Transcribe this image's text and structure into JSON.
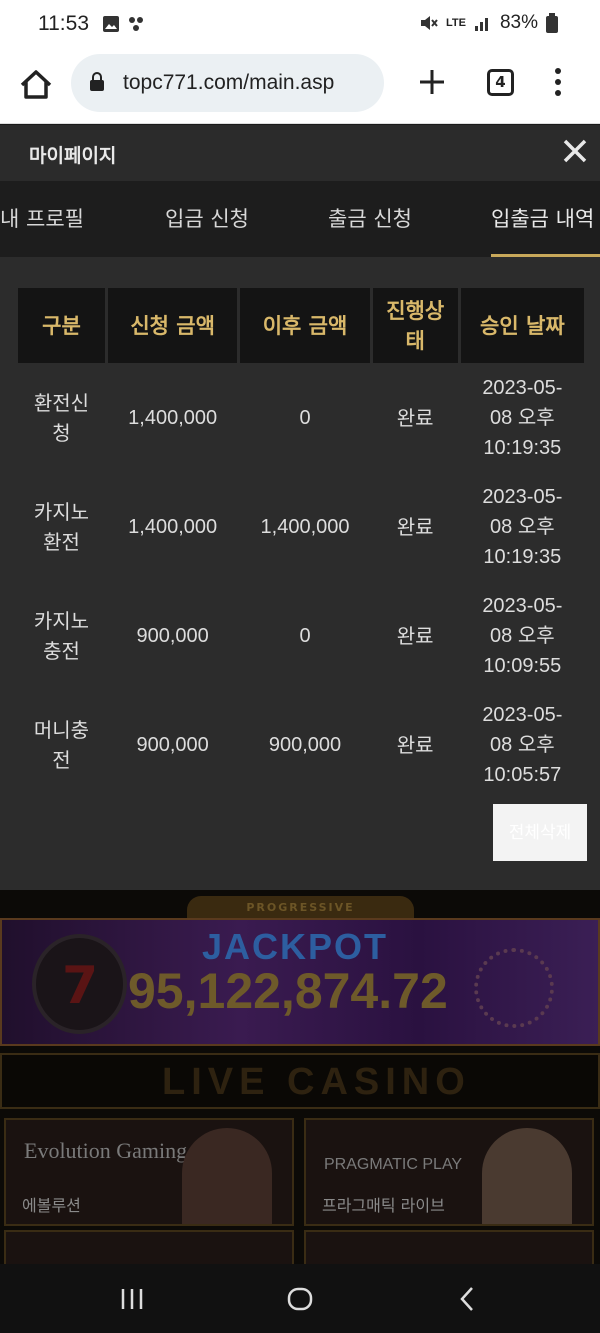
{
  "status": {
    "time": "11:53",
    "battery": "83%",
    "network": "LTE"
  },
  "browser": {
    "url": "topc771.com/main.asp",
    "tab_count": "4"
  },
  "mypage": {
    "title": "마이페이지",
    "tabs": [
      "내 프로필",
      "입금 신청",
      "출금 신청",
      "입출금 내역"
    ],
    "active_tab": "입출금 내역",
    "table": {
      "headers": [
        "구분",
        "신청 금액",
        "이후 금액",
        "진행상\n태",
        "승인 날짜"
      ],
      "rows": [
        {
          "type": "환전신\n청",
          "request": "1,400,000",
          "after": "0",
          "status": "완료",
          "date": "2023-05-\n08 오후\n10:19:35"
        },
        {
          "type": "카지노\n환전",
          "request": "1,400,000",
          "after": "1,400,000",
          "status": "완료",
          "date": "2023-05-\n08 오후\n10:19:35"
        },
        {
          "type": "카지노\n충전",
          "request": "900,000",
          "after": "0",
          "status": "완료",
          "date": "2023-05-\n08 오후\n10:09:55"
        },
        {
          "type": "머니충\n전",
          "request": "900,000",
          "after": "900,000",
          "status": "완료",
          "date": "2023-05-\n08 오후\n10:05:57"
        }
      ]
    },
    "delete_all_label": "전체삭제"
  },
  "casino": {
    "progressive_label": "PROGRESSIVE",
    "jackpot_label": "JACKPOT",
    "jackpot_amount": "95,122,874.72",
    "live_label": "LIVE CASINO",
    "games": [
      {
        "brand": "Evolution Gaming",
        "name": "에볼루션"
      },
      {
        "brand": "PRAGMATIC PLAY",
        "name": "프라그매틱 라이브"
      }
    ]
  },
  "colors": {
    "accent": "#d9b86a",
    "panel": "#2c2c2c",
    "header_cell": "#141414"
  },
  "icons": [
    "home-icon",
    "lock-icon",
    "plus-icon",
    "tabs-icon",
    "menu-icon",
    "close-icon",
    "recents-icon",
    "nav-home-icon",
    "back-icon"
  ]
}
